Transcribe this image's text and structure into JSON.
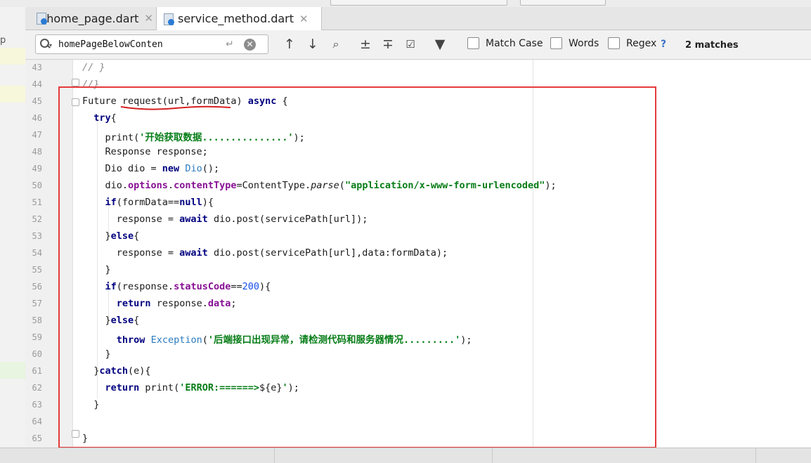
{
  "tabs": [
    {
      "label": "home_page.dart",
      "active": false
    },
    {
      "label": "service_method.dart",
      "active": true
    }
  ],
  "left_panel": {
    "letter": "p"
  },
  "search": {
    "query": "homePageBelowConten",
    "match_case_label": "Match Case",
    "words_label": "Words",
    "regex_label": "Regex",
    "help": "?",
    "matches": "2 matches"
  },
  "colors": {
    "highlight_box": "#e53a3a",
    "keyword": "#000080",
    "string": "#067d17",
    "field": "#871094"
  },
  "code_lines": [
    43,
    44,
    45,
    46,
    47,
    48,
    49,
    50,
    51,
    52,
    53,
    54,
    55,
    56,
    57,
    58,
    59,
    60,
    61,
    62,
    63,
    64,
    65
  ]
}
